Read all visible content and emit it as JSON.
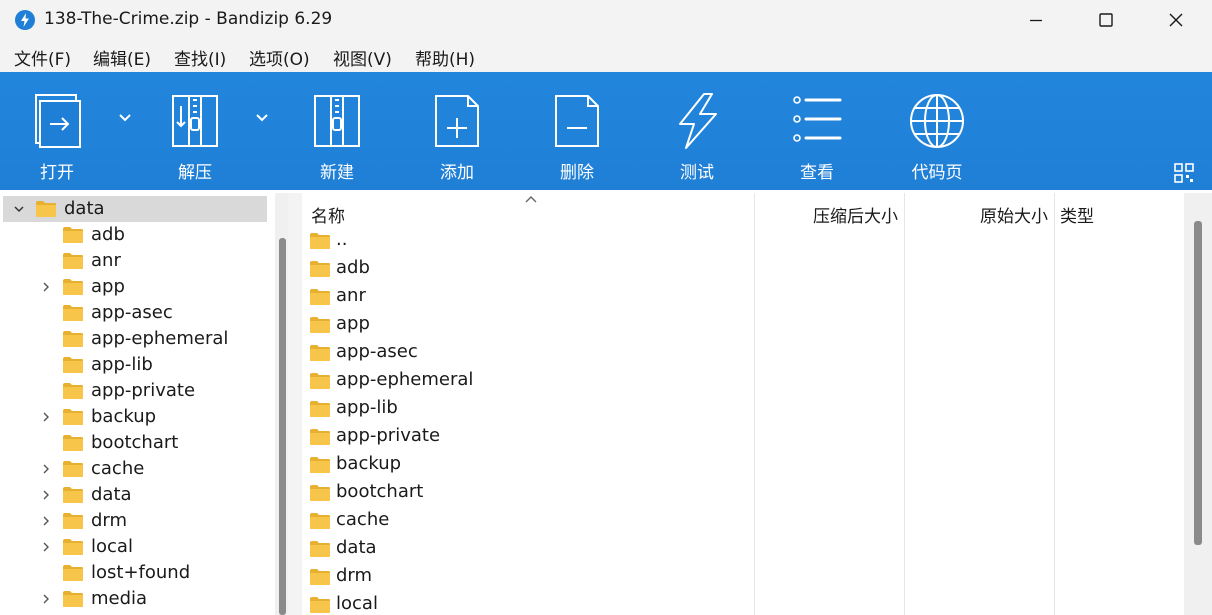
{
  "window": {
    "title": "138-The-Crime.zip - Bandizip 6.29",
    "app_icon": "bandizip-icon",
    "controls": [
      "minimize-icon",
      "maximize-icon",
      "close-icon"
    ]
  },
  "menu": [
    "文件(F)",
    "编辑(E)",
    "查找(I)",
    "选项(O)",
    "视图(V)",
    "帮助(H)"
  ],
  "toolbar": {
    "buttons": [
      {
        "label": "打开",
        "icon": "open-icon",
        "dropdown": true
      },
      {
        "label": "解压",
        "icon": "extract-icon",
        "dropdown": true
      },
      {
        "label": "新建",
        "icon": "new-archive-icon",
        "dropdown": false
      },
      {
        "label": "添加",
        "icon": "add-file-icon",
        "dropdown": false
      },
      {
        "label": "删除",
        "icon": "delete-file-icon",
        "dropdown": false
      },
      {
        "label": "测试",
        "icon": "test-icon",
        "dropdown": false
      },
      {
        "label": "查看",
        "icon": "view-list-icon",
        "dropdown": false
      },
      {
        "label": "代码页",
        "icon": "codepage-globe-icon",
        "dropdown": false
      }
    ],
    "layout_icon": "layout-grid-icon",
    "background": "#1f7fd6"
  },
  "tree": {
    "root": {
      "label": "data",
      "expanded": true
    },
    "items": [
      {
        "label": "adb",
        "expandable": false
      },
      {
        "label": "anr",
        "expandable": false
      },
      {
        "label": "app",
        "expandable": true
      },
      {
        "label": "app-asec",
        "expandable": false
      },
      {
        "label": "app-ephemeral",
        "expandable": false
      },
      {
        "label": "app-lib",
        "expandable": false
      },
      {
        "label": "app-private",
        "expandable": false
      },
      {
        "label": "backup",
        "expandable": true
      },
      {
        "label": "bootchart",
        "expandable": false
      },
      {
        "label": "cache",
        "expandable": true
      },
      {
        "label": "data",
        "expandable": true
      },
      {
        "label": "drm",
        "expandable": true
      },
      {
        "label": "local",
        "expandable": true
      },
      {
        "label": "lost+found",
        "expandable": false
      },
      {
        "label": "media",
        "expandable": true
      }
    ]
  },
  "list": {
    "columns": [
      "名称",
      "压缩后大小",
      "原始大小",
      "类型"
    ],
    "rows": [
      "..",
      "adb",
      "anr",
      "app",
      "app-asec",
      "app-ephemeral",
      "app-lib",
      "app-private",
      "backup",
      "bootchart",
      "cache",
      "data",
      "drm",
      "local"
    ]
  },
  "colors": {
    "folder": "#f7c54a",
    "folder_dark": "#e8b030",
    "selection": "#d9d9d9"
  }
}
